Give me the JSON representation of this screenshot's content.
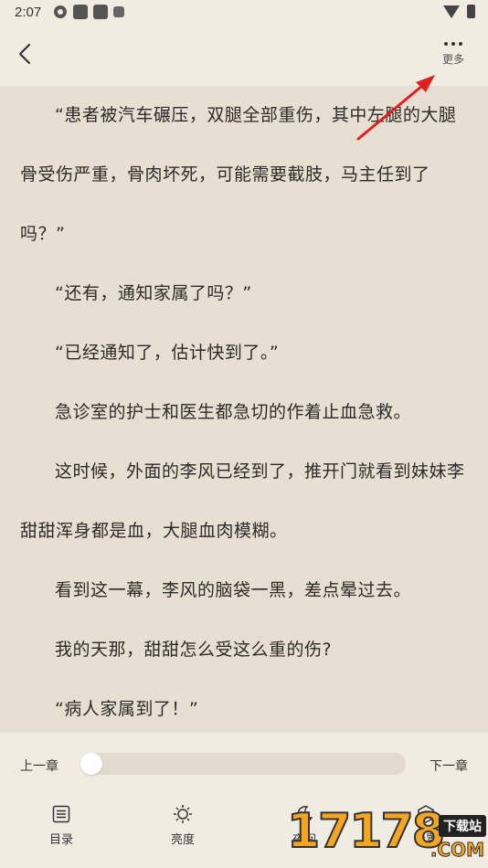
{
  "status_bar": {
    "time": "2:07",
    "icons": [
      "settings-icon",
      "notification-icon",
      "notification-icon",
      "app-icon",
      "wifi-icon",
      "battery-icon"
    ]
  },
  "toolbar": {
    "back_icon": "chevron-left-icon",
    "more_label": "更多",
    "more_icon": "more-dots-icon"
  },
  "reader": {
    "paragraphs": [
      "“患者被汽车碾压，双腿全部重伤，其中左腿的大腿骨受伤严重，骨肉坏死，可能需要截肢，马主任到了吗？”",
      "“还有，通知家属了吗？”",
      "“已经通知了，估计快到了。”",
      "急诊室的护士和医生都急切的作着止血急救。",
      "这时候，外面的李风已经到了，推开门就看到妹妹李甜甜浑身都是血，大腿血肉模糊。",
      "看到这一幕，李风的脑袋一黑，差点晕过去。",
      "我的天那，甜甜怎么受这么重的伤?",
      "“病人家属到了！”"
    ]
  },
  "chapter_nav": {
    "prev_label": "上一章",
    "next_label": "下一章",
    "progress": 0.0
  },
  "bottom_nav": {
    "items": [
      {
        "label": "目录",
        "icon": "list-icon"
      },
      {
        "label": "亮度",
        "icon": "brightness-icon"
      },
      {
        "label": "夜间",
        "icon": "moon-icon"
      },
      {
        "label": "设置",
        "icon": "settings-icon"
      }
    ]
  },
  "watermark": {
    "text": "17178",
    "badge": "下载站",
    "suffix": ".COM"
  },
  "colors": {
    "page_bg": "#e6dfd2",
    "bar_bg": "#f1ece2",
    "text": "#2d2b28",
    "annotation_arrow": "#e02020"
  }
}
